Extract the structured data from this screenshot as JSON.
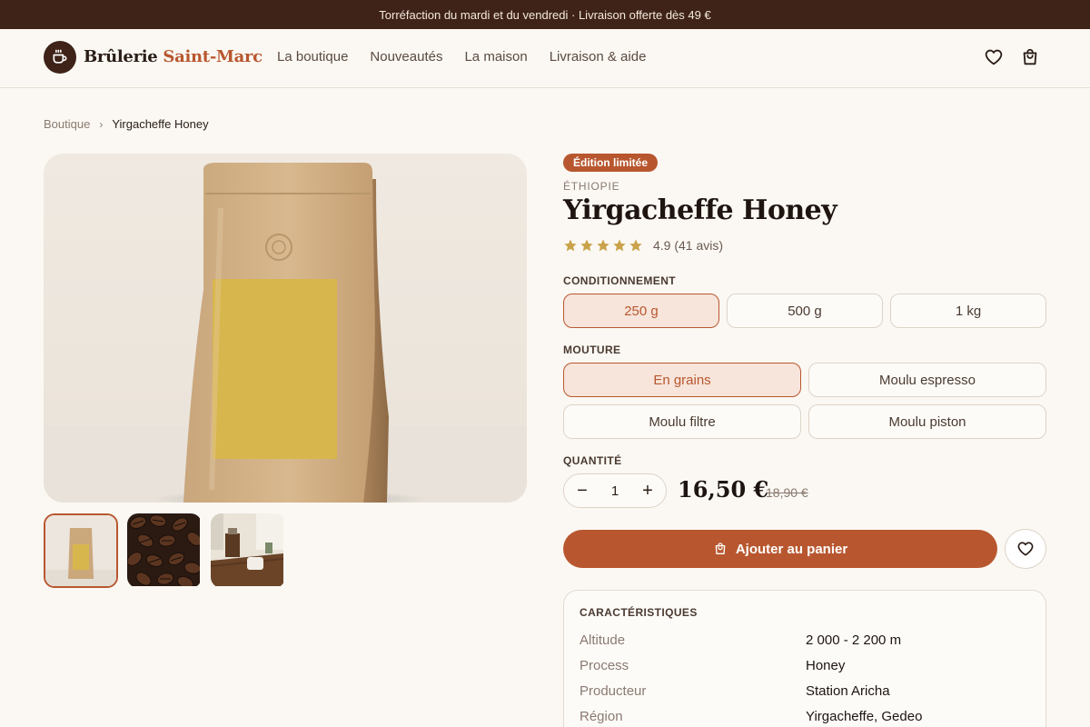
{
  "promo": {
    "text": "Torréfaction du mardi et du vendredi · Livraison offerte dès 49 €"
  },
  "brand": {
    "name_part1": "Brûlerie",
    "name_part2": "Saint-Marc",
    "logo_icon": "coffee-cup-icon"
  },
  "nav": {
    "items": [
      "La boutique",
      "Nouveautés",
      "La maison",
      "Livraison & aide"
    ]
  },
  "header_icons": [
    "heart-icon",
    "shopping-bag-icon"
  ],
  "breadcrumb": {
    "items": [
      "Boutique",
      "Yirgacheffe Honey"
    ]
  },
  "gallery": {
    "main": "kraft-coffee-bag",
    "thumbnails": [
      {
        "subject": "kraft-coffee-bag",
        "selected": true
      },
      {
        "subject": "roasted-coffee-beans",
        "selected": false
      },
      {
        "subject": "coffee-grinder-and-cup",
        "selected": false
      }
    ]
  },
  "product": {
    "badge": "Édition limitée",
    "origin": "ÉTHIOPIE",
    "title": "Yirgacheffe Honey",
    "rating": {
      "stars": 5,
      "text": "4.9 (41 avis)"
    }
  },
  "packaging": {
    "label": "CONDITIONNEMENT",
    "options": [
      "250 g",
      "500 g",
      "1 kg"
    ],
    "selected": "250 g"
  },
  "grind": {
    "label": "MOUTURE",
    "options": [
      "En grains",
      "Moulu espresso",
      "Moulu filtre",
      "Moulu piston"
    ],
    "selected": "En grains"
  },
  "quantity": {
    "label": "QUANTITÉ",
    "value": "1",
    "minus": "−",
    "plus": "+"
  },
  "price": {
    "current": "16,50 €",
    "old": "18,90 €"
  },
  "actions": {
    "add_to_cart": "Ajouter au panier"
  },
  "specs": {
    "title": "CARACTÉRISTIQUES",
    "rows": [
      {
        "key": "Altitude",
        "value": "2 000 - 2 200 m"
      },
      {
        "key": "Process",
        "value": "Honey"
      },
      {
        "key": "Producteur",
        "value": "Station Aricha"
      },
      {
        "key": "Région",
        "value": "Yirgacheffe, Gedeo"
      }
    ]
  },
  "colors": {
    "accent": "#b8572f",
    "dark": "#3f2318",
    "background": "#fbf8f3",
    "star": "#c9a24a"
  }
}
